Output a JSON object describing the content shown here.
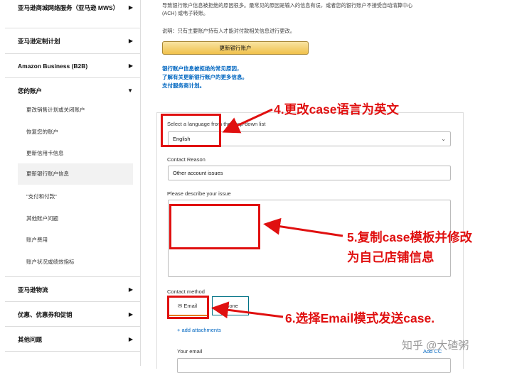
{
  "sidebar": {
    "sections": [
      {
        "label": "亚马逊商城网络服务（亚马逊 MWS）"
      },
      {
        "label": "亚马逊定制计划"
      },
      {
        "label": "Amazon Business (B2B)"
      },
      {
        "label": "您的账户"
      },
      {
        "label": "亚马逊物流"
      },
      {
        "label": "优惠、优惠券和促销"
      },
      {
        "label": "其他问题"
      }
    ],
    "account_items": [
      {
        "label": "更改销售计划或关闭账户"
      },
      {
        "label": "恢复您的账户"
      },
      {
        "label": "更新信用卡信息"
      },
      {
        "label": "更新银行账户信息"
      },
      {
        "label": "\"支付和付款\""
      },
      {
        "label": "其他账户问题"
      },
      {
        "label": "账户费用"
      },
      {
        "label": "账户状况或绩效指标"
      }
    ]
  },
  "main": {
    "intro_line1": "导致银行账户信息被拒绝的原因很多。最常见的原因是输入的信息有误，或者您的银行账户不接受自动清算中心",
    "intro_line2": "(ACH) 或电子转账。",
    "note": "说明：只有主要账户持有人才能对付款相关信息进行更改。",
    "update_button": "更新银行账户",
    "links": [
      "银行账户信息被拒绝的常见原因，",
      "了解有关更新银行账户的更多信息。",
      "支付服务商计划。"
    ],
    "form": {
      "language_label": "Select a language from the drop-down list",
      "language_value": "English",
      "reason_label": "Contact Reason",
      "reason_value": "Other account issues",
      "describe_label": "Please describe your issue",
      "method_label": "Contact method",
      "email_tab": "Email",
      "phone_tab": "Phone",
      "add_attachments": "+ add attachments",
      "your_email_label": "Your email",
      "add_cc": "Add CC"
    }
  },
  "annotations": {
    "step4": "4.更改case语言为英文",
    "step5_line1": "5.复制case模板并修改",
    "step5_line2": "为自己店铺信息",
    "step6": "6.选择Email模式发送case."
  },
  "watermark": "知乎 @大碴粥",
  "colors": {
    "annotation": "#e01010",
    "link": "#0066c0",
    "button": "#f0c14b",
    "tab_accent": "#e47911"
  }
}
